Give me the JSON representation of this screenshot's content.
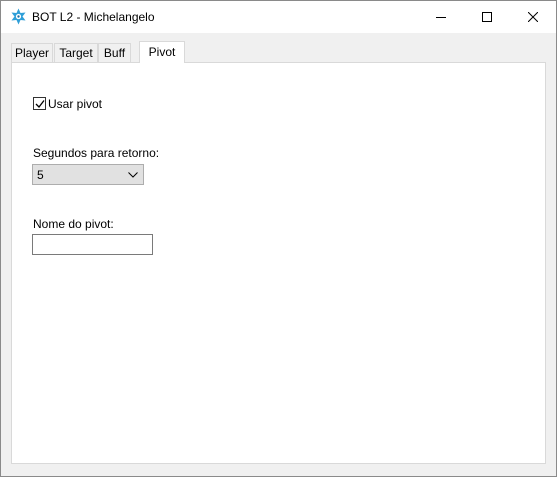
{
  "window": {
    "title": "BOT L2 - Michelangelo",
    "icon": "gear-star-app-icon",
    "controls": [
      "minimize",
      "maximize",
      "close"
    ]
  },
  "tabs": [
    {
      "label": "Player",
      "active": false
    },
    {
      "label": "Target",
      "active": false
    },
    {
      "label": "Buff",
      "active": false
    },
    {
      "label": "Pivot",
      "active": true
    }
  ],
  "pivot": {
    "use_pivot_label": "Usar pivot",
    "use_pivot_checked": true,
    "return_seconds_label": "Segundos para retorno:",
    "return_seconds_value": "5",
    "pivot_name_label": "Nome do pivot:",
    "pivot_name_value": ""
  },
  "colors": {
    "window_bg": "#f0f0f0",
    "panel_bg": "#ffffff",
    "icon_blue": "#2f9fd8"
  }
}
